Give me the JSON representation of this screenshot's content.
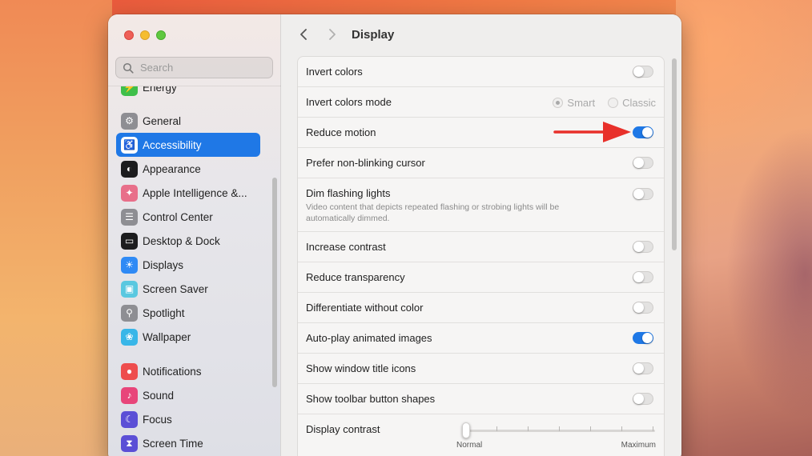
{
  "window": {
    "title": "Display"
  },
  "search": {
    "placeholder": "Search"
  },
  "sidebar": {
    "items": [
      {
        "label": "Energy",
        "icon": "energy-icon",
        "color": "#3fbf4a",
        "active": false
      },
      {
        "label": "General",
        "icon": "gear-icon",
        "color": "#8e8e93",
        "active": false
      },
      {
        "label": "Accessibility",
        "icon": "accessibility-icon",
        "color": "#1f78e6",
        "active": true
      },
      {
        "label": "Appearance",
        "icon": "appearance-icon",
        "color": "#1c1c1e",
        "active": false
      },
      {
        "label": "Apple Intelligence &...",
        "icon": "apple-intelligence-icon",
        "color": "#e86f8a",
        "active": false
      },
      {
        "label": "Control Center",
        "icon": "control-center-icon",
        "color": "#8e8e93",
        "active": false
      },
      {
        "label": "Desktop & Dock",
        "icon": "desktop-dock-icon",
        "color": "#1c1c1e",
        "active": false
      },
      {
        "label": "Displays",
        "icon": "displays-icon",
        "color": "#2f8af5",
        "active": false
      },
      {
        "label": "Screen Saver",
        "icon": "screen-saver-icon",
        "color": "#5ac8e0",
        "active": false
      },
      {
        "label": "Spotlight",
        "icon": "spotlight-icon",
        "color": "#8e8e93",
        "active": false
      },
      {
        "label": "Wallpaper",
        "icon": "wallpaper-icon",
        "color": "#38b6e8",
        "active": false
      },
      {
        "label": "Notifications",
        "icon": "notifications-icon",
        "color": "#ee4d4d",
        "active": false
      },
      {
        "label": "Sound",
        "icon": "sound-icon",
        "color": "#e8457a",
        "active": false
      },
      {
        "label": "Focus",
        "icon": "focus-icon",
        "color": "#5b4fd6",
        "active": false
      },
      {
        "label": "Screen Time",
        "icon": "screen-time-icon",
        "color": "#5b4fd6",
        "active": false
      }
    ]
  },
  "settings": {
    "invert_colors": {
      "label": "Invert colors",
      "on": false
    },
    "invert_colors_mode": {
      "label": "Invert colors mode",
      "options": [
        "Smart",
        "Classic"
      ],
      "selected": "Smart"
    },
    "reduce_motion": {
      "label": "Reduce motion",
      "on": true
    },
    "non_blinking_cursor": {
      "label": "Prefer non-blinking cursor",
      "on": false
    },
    "dim_flashing": {
      "label": "Dim flashing lights",
      "sub": "Video content that depicts repeated flashing or strobing lights will be automatically dimmed.",
      "on": false
    },
    "increase_contrast": {
      "label": "Increase contrast",
      "on": false
    },
    "reduce_transparency": {
      "label": "Reduce transparency",
      "on": false
    },
    "differentiate_color": {
      "label": "Differentiate without color",
      "on": false
    },
    "autoplay_images": {
      "label": "Auto-play animated images",
      "on": true
    },
    "window_title_icons": {
      "label": "Show window title icons",
      "on": false
    },
    "toolbar_button_shapes": {
      "label": "Show toolbar button shapes",
      "on": false
    },
    "display_contrast": {
      "label": "Display contrast",
      "min_label": "Normal",
      "max_label": "Maximum",
      "value": 0
    }
  },
  "colors": {
    "accent": "#1f78e6",
    "annotation_arrow": "#e8302a"
  }
}
